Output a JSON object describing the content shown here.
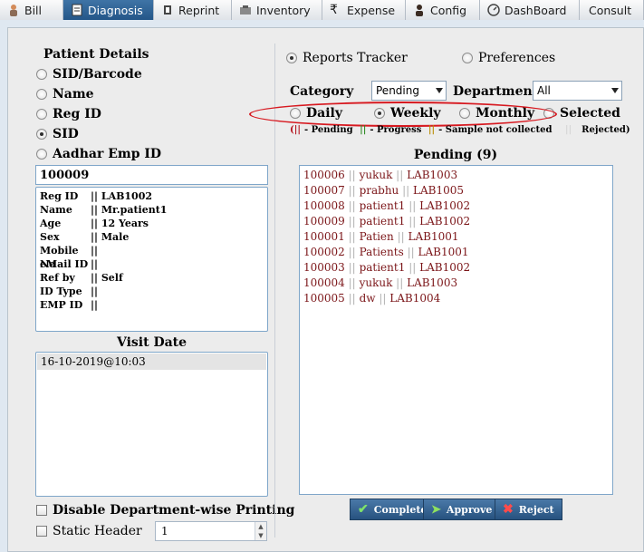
{
  "tabs": [
    {
      "label": "Bill",
      "icon": "person-icon"
    },
    {
      "label": "Diagnosis",
      "icon": "document-icon",
      "active": true
    },
    {
      "label": "Reprint",
      "icon": "reprint-icon"
    },
    {
      "label": "Inventory",
      "icon": "inventory-icon"
    },
    {
      "label": "Expense",
      "icon": "rupee-icon"
    },
    {
      "label": "Config",
      "icon": "user-config-icon"
    },
    {
      "label": "DashBoard",
      "icon": "dashboard-icon"
    },
    {
      "label": "Consult",
      "icon": ""
    }
  ],
  "patient": {
    "title": "Patient Details",
    "search_options": [
      {
        "label": "SID/Barcode",
        "selected": false
      },
      {
        "label": "Name",
        "selected": false
      },
      {
        "label": "Reg ID",
        "selected": false
      },
      {
        "label": "SID",
        "selected": true
      },
      {
        "label": "Aadhar Emp ID",
        "selected": false
      }
    ],
    "sid_value": "100009",
    "info": [
      {
        "k": "Reg ID",
        "v": "|| LAB1002"
      },
      {
        "k": "Name",
        "v": "|| Mr.patient1"
      },
      {
        "k": "Age",
        "v": "|| 12 Years"
      },
      {
        "k": "Sex",
        "v": "|| Male"
      },
      {
        "k": "Mobile No",
        "v": "||"
      },
      {
        "k": "eMail ID",
        "v": "||"
      },
      {
        "k": "Ref by",
        "v": "|| Self"
      },
      {
        "k": "ID Type",
        "v": "||"
      },
      {
        "k": "EMP ID",
        "v": "||"
      }
    ],
    "visit_title": "Visit Date",
    "visits": [
      "16-10-2019@10:03"
    ],
    "disable_dept_printing": "Disable Department-wise Printing",
    "static_header": "Static Header",
    "static_header_value": "1"
  },
  "reports": {
    "tracker_label": "Reports Tracker",
    "preferences_label": "Preferences",
    "category_label": "Category",
    "category_value": "Pending",
    "department_label": "Department",
    "department_value": "All",
    "periods": [
      {
        "label": "Daily",
        "selected": false
      },
      {
        "label": "Weekly",
        "selected": true
      },
      {
        "label": "Monthly",
        "selected": false
      },
      {
        "label": "Selected",
        "selected": false
      }
    ],
    "legend": {
      "pending": "- Pending",
      "progress": "- Progress",
      "not_collected": "- Sample not collected",
      "rejected": "Rejected)"
    },
    "pending_title": "Pending (9)",
    "pending_items": [
      {
        "sid": "100006",
        "name": "yukuk",
        "lab": "LAB1003"
      },
      {
        "sid": "100007",
        "name": "prabhu",
        "lab": "LAB1005"
      },
      {
        "sid": "100008",
        "name": "patient1",
        "lab": "LAB1002"
      },
      {
        "sid": "100009",
        "name": "patient1",
        "lab": "LAB1002"
      },
      {
        "sid": "100001",
        "name": "Patien",
        "lab": "LAB1001"
      },
      {
        "sid": "100002",
        "name": "Patients",
        "lab": "LAB1001"
      },
      {
        "sid": "100003",
        "name": "patient1",
        "lab": "LAB1002"
      },
      {
        "sid": "100004",
        "name": "yukuk",
        "lab": "LAB1003"
      },
      {
        "sid": "100005",
        "name": "dw",
        "lab": "LAB1004"
      }
    ],
    "buttons": {
      "complete": "Complete",
      "approve": "Approve",
      "reject": "Reject"
    }
  }
}
